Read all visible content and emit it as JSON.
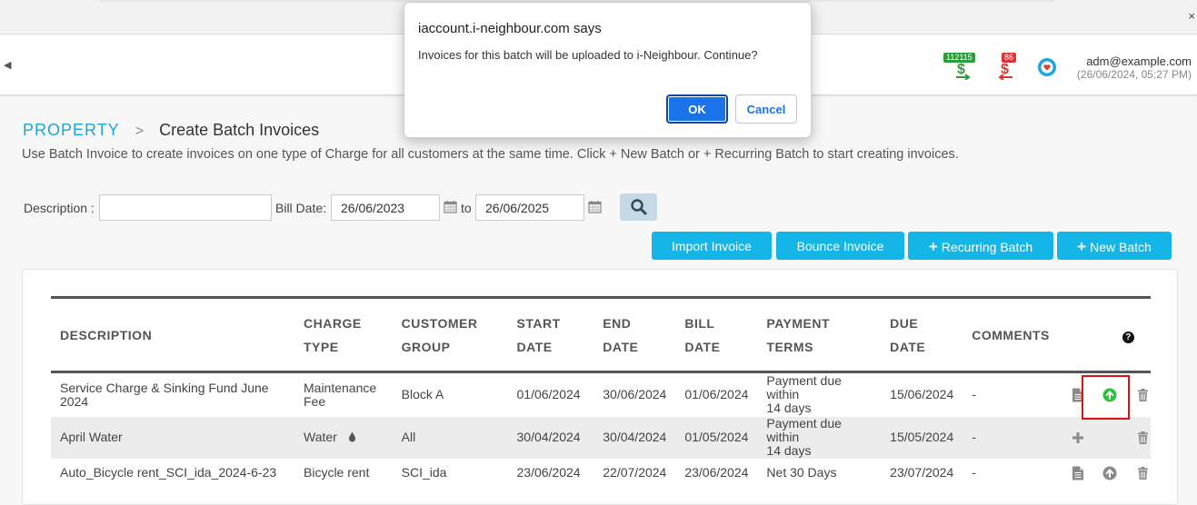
{
  "dialog": {
    "title": "iaccount.i-neighbour.com says",
    "message": "Invoices for this batch will be uploaded to i-Neighbour. Continue?",
    "ok_label": "OK",
    "cancel_label": "Cancel"
  },
  "header": {
    "badge_green": "112115",
    "badge_red": "86",
    "user_email": "adm@example.com",
    "user_time": "(26/06/2024, 05:27 PM)"
  },
  "breadcrumb": {
    "parent": "PROPERTY",
    "separator": ">",
    "current": "Create Batch Invoices"
  },
  "intro": "Use Batch Invoice to create invoices on one type of Charge for all customers at the same time. Click + New Batch or + Recurring Batch to start creating invoices.",
  "filter": {
    "description_label": "Description :",
    "description_value": "",
    "bill_date_label": "Bill Date:",
    "from_date": "26/06/2023",
    "to_label": "to",
    "to_date": "26/06/2025"
  },
  "actions": {
    "import_invoice": "Import Invoice",
    "bounce_invoice": "Bounce Invoice",
    "recurring_batch": "Recurring Batch",
    "new_batch": "New Batch"
  },
  "table": {
    "columns": [
      {
        "line1": "DESCRIPTION",
        "line2": ""
      },
      {
        "line1": "CHARGE",
        "line2": "TYPE"
      },
      {
        "line1": "CUSTOMER",
        "line2": "GROUP"
      },
      {
        "line1": "START",
        "line2": "DATE"
      },
      {
        "line1": "END",
        "line2": "DATE"
      },
      {
        "line1": "BILL",
        "line2": "DATE"
      },
      {
        "line1": "PAYMENT TERMS",
        "line2": ""
      },
      {
        "line1": "DUE",
        "line2": "DATE"
      },
      {
        "line1": "COMMENTS",
        "line2": ""
      }
    ],
    "help_glyph": "?",
    "rows": [
      {
        "description": "Service Charge & Sinking Fund June 2024",
        "charge_type_1": "Maintenance",
        "charge_type_2": "Fee",
        "customer_group": "Block A",
        "start_date": "01/06/2024",
        "end_date": "30/06/2024",
        "bill_date": "01/06/2024",
        "payment_terms_1": "Payment due within",
        "payment_terms_2": "14 days",
        "due_date": "15/06/2024",
        "comments": "-"
      },
      {
        "description": "April Water",
        "charge_type_1": "Water",
        "charge_type_2": "",
        "customer_group": "All",
        "start_date": "30/04/2024",
        "end_date": "30/04/2024",
        "bill_date": "01/05/2024",
        "payment_terms_1": "Payment due within",
        "payment_terms_2": "14 days",
        "due_date": "15/05/2024",
        "comments": "-"
      },
      {
        "description": "Auto_Bicycle rent_SCI_ida_2024-6-23",
        "charge_type_1": "Bicycle rent",
        "charge_type_2": "",
        "customer_group": "SCI_ida",
        "start_date": "23/06/2024",
        "end_date": "22/07/2024",
        "bill_date": "23/06/2024",
        "payment_terms_1": "Net 30 Days",
        "payment_terms_2": "",
        "due_date": "23/07/2024",
        "comments": "-"
      }
    ]
  },
  "icons": {
    "search": "magnifier-icon",
    "calendar": "calendar-icon",
    "document": "document-icon",
    "upload": "upload-circle-icon",
    "trash": "trash-icon",
    "plus": "plus-icon",
    "water_drop": "water-drop-icon"
  },
  "colors": {
    "accent": "#14b6e8",
    "link": "#1aa6d8",
    "upload_active": "#2fbf3a",
    "highlight": "#dd1111"
  }
}
